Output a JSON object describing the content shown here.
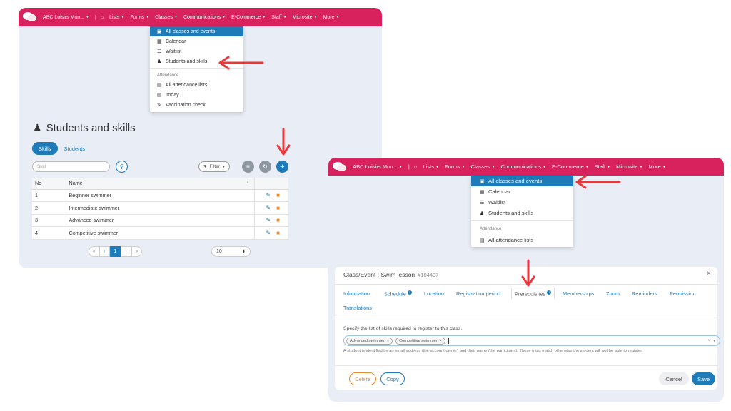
{
  "nav": {
    "brand": "ABC Loisirs Mun...",
    "items": [
      "Lists",
      "Forms",
      "Classes",
      "Communications",
      "E-Commerce",
      "Staff",
      "Microsite",
      "More"
    ]
  },
  "classes_menu": {
    "items": [
      {
        "label": "All classes and events",
        "icon": "calendar-check-icon"
      },
      {
        "label": "Calendar",
        "icon": "calendar-icon"
      },
      {
        "label": "Waitlist",
        "icon": "list-icon"
      },
      {
        "label": "Students and skills",
        "icon": "graduate-icon"
      }
    ],
    "attendance_header": "Attendance",
    "attendance_items": [
      {
        "label": "All attendance lists",
        "icon": "clipboard-icon"
      },
      {
        "label": "Today",
        "icon": "clipboard-icon"
      },
      {
        "label": "Vaccination check",
        "icon": "syringe-icon"
      }
    ]
  },
  "skills_page": {
    "title": "Students and skills",
    "tabs": [
      "Skills",
      "Students"
    ],
    "search_placeholder": "Skill",
    "filter_label": "Filter",
    "columns": [
      "No",
      "Name"
    ],
    "rows": [
      {
        "no": "1",
        "name": "Beginner swimmer"
      },
      {
        "no": "2",
        "name": "Intermediate swimmer"
      },
      {
        "no": "3",
        "name": "Advanced swimmer"
      },
      {
        "no": "4",
        "name": "Competitive swimmer"
      }
    ],
    "pager": {
      "first": "«",
      "prev": "‹",
      "current": "1",
      "next": "›",
      "last": "»"
    },
    "per_page": "10"
  },
  "modal": {
    "title": "Class/Event : Swim lesson",
    "id": "#104437",
    "tabs_row1": [
      "Information",
      "Schedule",
      "Location",
      "Registration period",
      "Prerequisites",
      "Memberships",
      "Zoom",
      "Reminders",
      "Permission"
    ],
    "tabs_row2": [
      "Translations"
    ],
    "prereq_label": "Specify the list of skills required to register to this class.",
    "tags": [
      "Advanced swimmer",
      "Competitive swimmer"
    ],
    "help_text": "A student is identified by an email address (the account owner) and their name (the participant). These must match otherwise the student will not be able to register.",
    "buttons": {
      "delete": "Delete",
      "copy": "Copy",
      "cancel": "Cancel",
      "save": "Save"
    }
  },
  "colors": {
    "brand": "#d8225e",
    "accent": "#1f7ab8",
    "annotation_arrow": "#e8383b",
    "danger": "#ee8b2f"
  }
}
